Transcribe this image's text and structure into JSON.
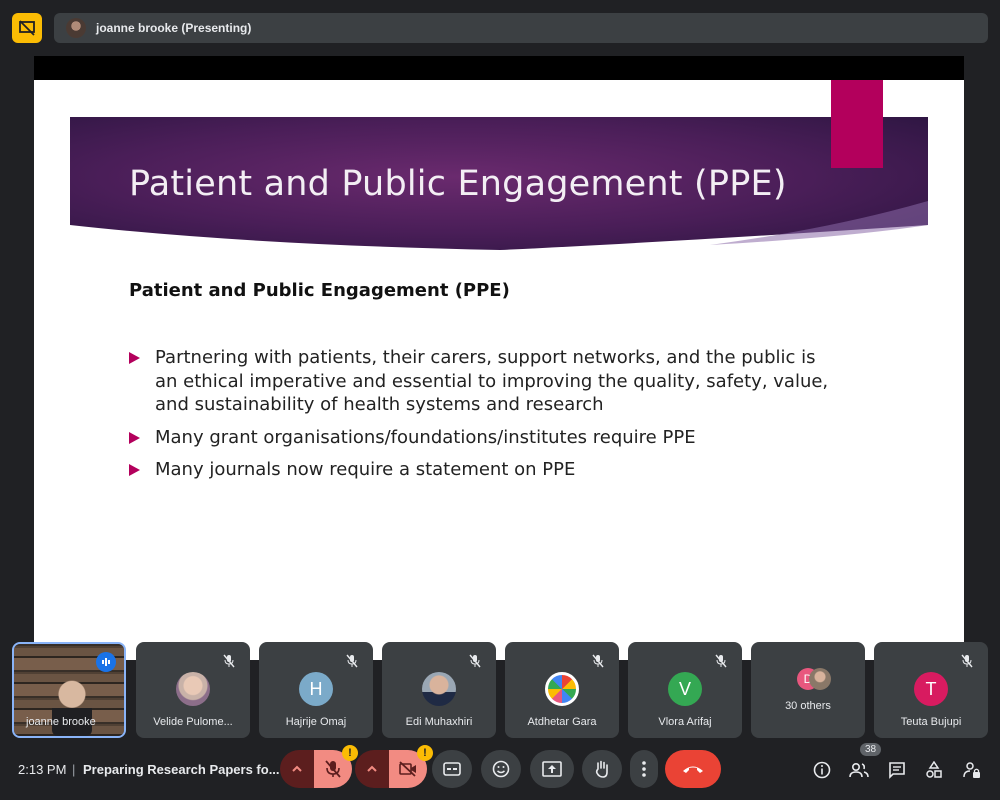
{
  "presenter": {
    "label": "joanne brooke (Presenting)"
  },
  "slide": {
    "title": "Patient and Public Engagement (PPE)",
    "subheading": "Patient and Public Engagement (PPE)",
    "bullets": [
      "Partnering with patients, their carers, support networks, and the public is an ethical imperative and essential to improving the quality, safety, value, and sustainability of health systems and research",
      "Many grant organisations/foundations/institutes require PPE",
      "Many journals now require a statement on PPE"
    ],
    "colors": {
      "accent": "#b3005c",
      "banner_dark": "#2b1540",
      "banner_mid": "#6a2a6e"
    }
  },
  "participants": [
    {
      "name": "joanne brooke",
      "type": "video",
      "speaking": true
    },
    {
      "name": "Velide Pulome...",
      "type": "photo",
      "muted": true
    },
    {
      "name": "Hajrije Omaj",
      "type": "initial",
      "initial": "H",
      "color": "#7baac9",
      "muted": true
    },
    {
      "name": "Edi Muhaxhiri",
      "type": "photo",
      "muted": true
    },
    {
      "name": "Atdhetar Gara",
      "type": "photo",
      "muted": true
    },
    {
      "name": "Vlora Arifaj",
      "type": "initial",
      "initial": "V",
      "color": "#34a853",
      "muted": true
    },
    {
      "name": "30 others",
      "type": "group",
      "initial": "D",
      "color": "#e8577e"
    },
    {
      "name": "Teuta Bujupi",
      "type": "initial",
      "initial": "T",
      "color": "#d81b60",
      "muted": true
    }
  ],
  "bottom_bar": {
    "time": "2:13 PM",
    "separator": "|",
    "meeting_title": "Preparing Research Papers fo...",
    "participant_count": "38",
    "warn_mark": "!"
  }
}
